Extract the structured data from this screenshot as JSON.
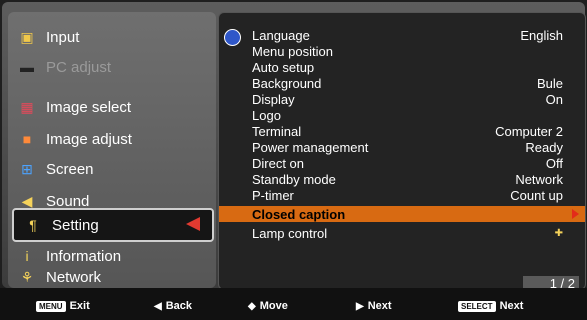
{
  "left_menu": [
    {
      "label": "Input",
      "icon": "input-icon",
      "dim": false
    },
    {
      "label": "PC adjust",
      "icon": "pc-adjust-icon",
      "dim": true
    },
    {
      "label": "Image select",
      "icon": "image-select-icon",
      "dim": false
    },
    {
      "label": "Image adjust",
      "icon": "image-adjust-icon",
      "dim": false
    },
    {
      "label": "Screen",
      "icon": "screen-icon",
      "dim": false
    },
    {
      "label": "Sound",
      "icon": "sound-icon",
      "dim": false
    },
    {
      "label": "Setting",
      "icon": "setting-icon",
      "dim": false,
      "selected": true
    },
    {
      "label": "Information",
      "icon": "information-icon",
      "dim": false
    },
    {
      "label": "Network",
      "icon": "network-icon",
      "dim": false
    }
  ],
  "right_menu": [
    {
      "label": "Language",
      "value": "English"
    },
    {
      "label": "Menu position",
      "value": ""
    },
    {
      "label": "Auto setup",
      "value": ""
    },
    {
      "label": "Background",
      "value": "Bule"
    },
    {
      "label": "Display",
      "value": "On"
    },
    {
      "label": "Logo",
      "value": ""
    },
    {
      "label": "Terminal",
      "value": "Computer 2"
    },
    {
      "label": "Power management",
      "value": "Ready"
    },
    {
      "label": "Direct on",
      "value": "Off"
    },
    {
      "label": "Standby mode",
      "value": "Network"
    },
    {
      "label": "P-timer",
      "value": "Count up"
    },
    {
      "label": "Closed caption",
      "value": "",
      "highlighted": true
    },
    {
      "label": "Lamp control",
      "value": ""
    }
  ],
  "page_indicator": "1 / 2",
  "footer": {
    "exit_key": "MENU",
    "exit_label": "Exit",
    "back_label": "Back",
    "move_label": "Move",
    "next_label": "Next",
    "select_key": "SELECT",
    "select_next_label": "Next"
  },
  "colors": {
    "highlight": "#d86a12",
    "selection_arrow": "#e23a30"
  }
}
